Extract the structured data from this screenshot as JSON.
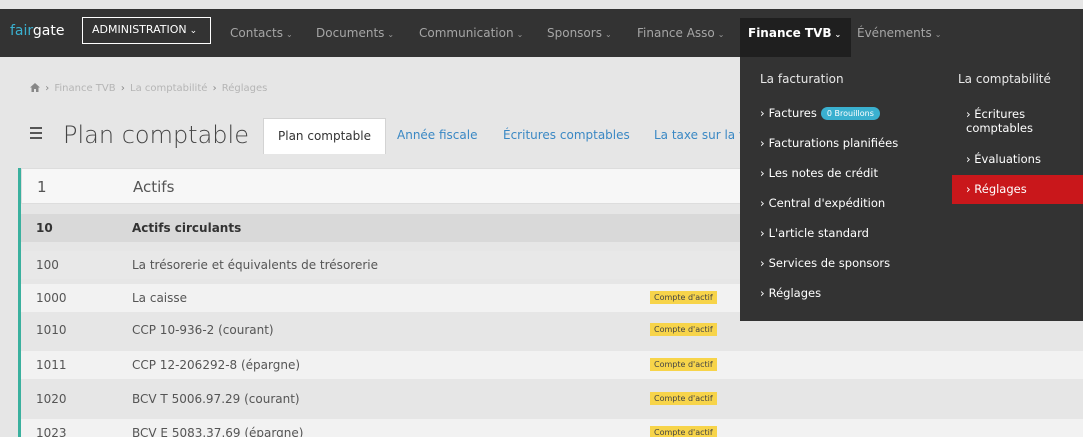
{
  "topbar": {
    "logo_fair": "fair",
    "logo_gate": "gate",
    "admin_label": "ADMINISTRATION",
    "admin_chevron": "⌄",
    "nav": [
      {
        "label": "Contacts"
      },
      {
        "label": "Documents"
      },
      {
        "label": "Communication"
      },
      {
        "label": "Sponsors"
      },
      {
        "label": "Finance Asso"
      },
      {
        "label": "Finance TVB"
      },
      {
        "label": "Événements"
      }
    ],
    "chevron": "⌄"
  },
  "breadcrumb": {
    "home_icon": "home-icon",
    "items": [
      "Finance TVB",
      "La comptabilité",
      "Réglages"
    ],
    "sep": "›"
  },
  "header": {
    "menu_icon": "hamburger-icon",
    "title": "Plan comptable",
    "tabs": [
      {
        "label": "Plan comptable",
        "active": true
      },
      {
        "label": "Année fiscale"
      },
      {
        "label": "Écritures comptables"
      },
      {
        "label": "La taxe sur la v"
      }
    ]
  },
  "table": {
    "accent_color": "#3ab09e",
    "header_row": {
      "num": "1",
      "name": "Actifs"
    },
    "group_row": {
      "num": "10",
      "name": "Actifs circulants"
    },
    "sub_row": {
      "num": "100",
      "name": "La trésorerie et équivalents de trésorerie"
    },
    "items": [
      {
        "num": "1000",
        "name": "La caisse",
        "badge": "Compte d'actif"
      },
      {
        "num": "1010",
        "name": "CCP 10-936-2 (courant)",
        "badge": "Compte d'actif"
      },
      {
        "num": "1011",
        "name": "CCP 12-206292-8 (épargne)",
        "badge": "Compte d'actif"
      },
      {
        "num": "1020",
        "name": "BCV T 5006.97.29 (courant)",
        "badge": "Compte d'actif"
      },
      {
        "num": "1023",
        "name": "BCV E 5083.37.69 (épargne)",
        "badge": "Compte d'actif"
      }
    ]
  },
  "mega_menu": {
    "left_title": "La facturation",
    "right_title": "La comptabilité",
    "arrow": "›",
    "left_items": [
      {
        "label": "Factures",
        "badge": "0 Brouillons"
      },
      {
        "label": "Facturations planifiées"
      },
      {
        "label": "Les notes de crédit"
      },
      {
        "label": "Central d'expédition"
      },
      {
        "label": "L'article standard"
      },
      {
        "label": "Services de sponsors"
      },
      {
        "label": "Réglages"
      }
    ],
    "right_items": [
      {
        "label": "Écritures comptables"
      },
      {
        "label": "Évaluations"
      },
      {
        "label": "Réglages",
        "active": true
      }
    ],
    "active_color": "#c9171b",
    "badge_color": "#3ab0cf"
  }
}
